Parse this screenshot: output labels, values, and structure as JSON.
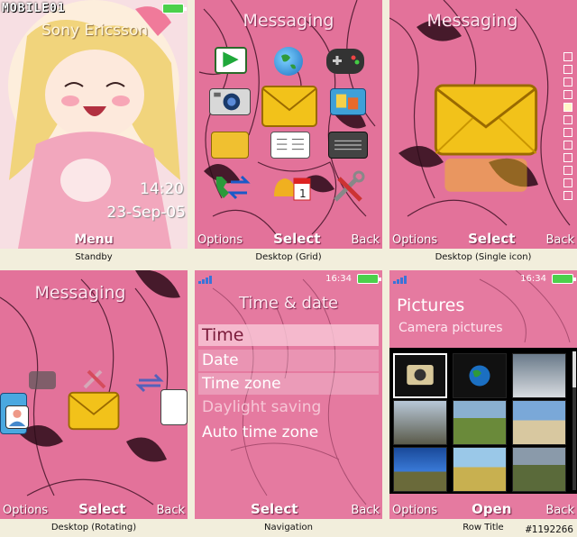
{
  "watermark_logo": "MOBILE01",
  "watermark_id": "#1192266",
  "softkeys": {
    "options": "Options",
    "select": "Select",
    "back": "Back",
    "menu": "Menu",
    "open": "Open"
  },
  "standby": {
    "operator": "Sony Ericsson",
    "time": "14:20",
    "date": "23-Sep-05",
    "caption": "Standby"
  },
  "grid": {
    "title": "Messaging",
    "caption": "Desktop (Grid)"
  },
  "single": {
    "title": "Messaging",
    "caption": "Desktop (Single icon)"
  },
  "rotating": {
    "title": "Messaging",
    "caption": "Desktop (Rotating)"
  },
  "navigation": {
    "clock": "16:34",
    "title": "Time & date",
    "items": [
      "Time",
      "Date",
      "Time zone",
      "Daylight saving",
      "Auto time zone"
    ],
    "caption": "Navigation"
  },
  "rowtitle": {
    "clock": "16:34",
    "title": "Pictures",
    "subtitle": "Camera pictures",
    "caption": "Row Title"
  },
  "colors": {
    "pink": "#e3729a",
    "highlight": "#f9c9d8",
    "envelope": "#f2c21a",
    "battery": "#4bd04b"
  }
}
